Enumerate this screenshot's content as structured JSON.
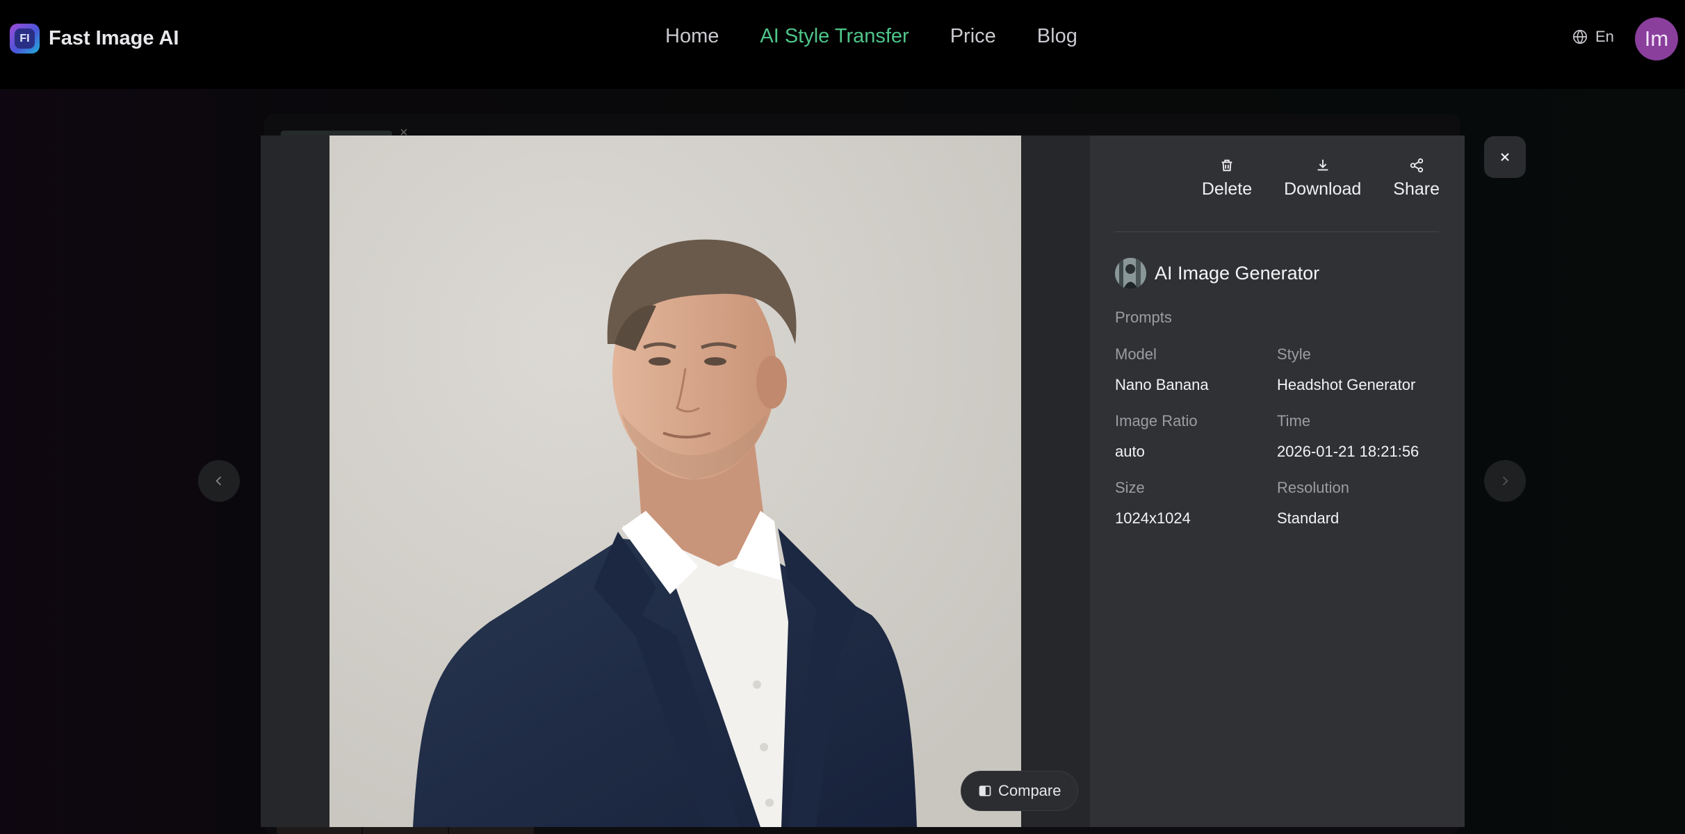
{
  "app": {
    "name": "Fast Image AI",
    "logo_text": "FI"
  },
  "nav": {
    "items": [
      {
        "label": "Home",
        "active": false
      },
      {
        "label": "AI Style Transfer",
        "active": true
      },
      {
        "label": "Price",
        "active": false
      },
      {
        "label": "Blog",
        "active": false
      }
    ],
    "accent_color": "#4fc48a"
  },
  "header": {
    "language": "En",
    "avatar_initials": "Im",
    "avatar_color": "#8a3f9c"
  },
  "viewer": {
    "compare_label": "Compare"
  },
  "actions": {
    "delete_label": "Delete",
    "download_label": "Download",
    "share_label": "Share"
  },
  "details": {
    "generator_title": "AI Image Generator",
    "prompts_label": "Prompts",
    "fields": [
      {
        "key": "Model",
        "value": "Nano Banana"
      },
      {
        "key": "Style",
        "value": "Headshot Generator"
      },
      {
        "key": "Image Ratio",
        "value": "auto"
      },
      {
        "key": "Time",
        "value": "2026-01-21 18:21:56"
      },
      {
        "key": "Size",
        "value": "1024x1024"
      },
      {
        "key": "Resolution",
        "value": "Standard"
      }
    ]
  }
}
